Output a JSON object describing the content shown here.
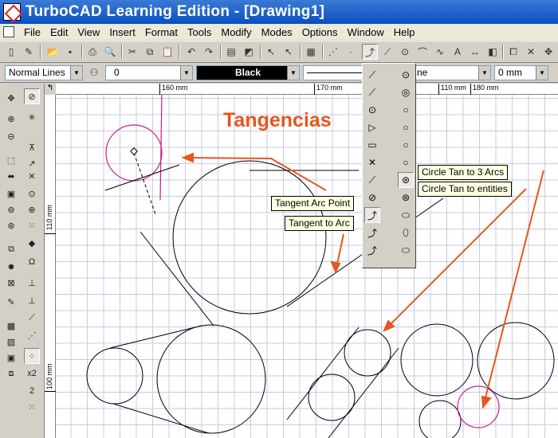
{
  "window": {
    "title": "TurboCAD Learning Edition - [Drawing1]"
  },
  "menu": [
    "File",
    "Edit",
    "View",
    "Insert",
    "Format",
    "Tools",
    "Modify",
    "Modes",
    "Options",
    "Window",
    "Help"
  ],
  "properties_bar": {
    "line_style": "Normal Lines",
    "layer": "0",
    "color": "Black",
    "linetype_value": "",
    "width_partial": "ne",
    "width_value": "0 mm"
  },
  "ruler": {
    "top_labels": [
      "160 mm",
      "170 mm",
      "110 mm",
      "180 mm"
    ],
    "left_labels": [
      "110 mm",
      "100 mm"
    ]
  },
  "left_toolbar_labels": [
    "x2",
    "2"
  ],
  "annotation": {
    "text": "Tangencias"
  },
  "tooltips": {
    "tangent_arc_point": "Tangent Arc Point",
    "tangent_to_arc": "Tangent to Arc",
    "circle_tan_3_arcs": "Circle Tan to 3 Arcs",
    "circle_tan_entities": "Circle Tan to entities"
  },
  "colors": {
    "title_bar": "#0a4fc0",
    "annotation": "#e4571e",
    "arrows": "#e4571e",
    "highlight_circle": "#c0208a",
    "grid": "#c8c8e6"
  }
}
